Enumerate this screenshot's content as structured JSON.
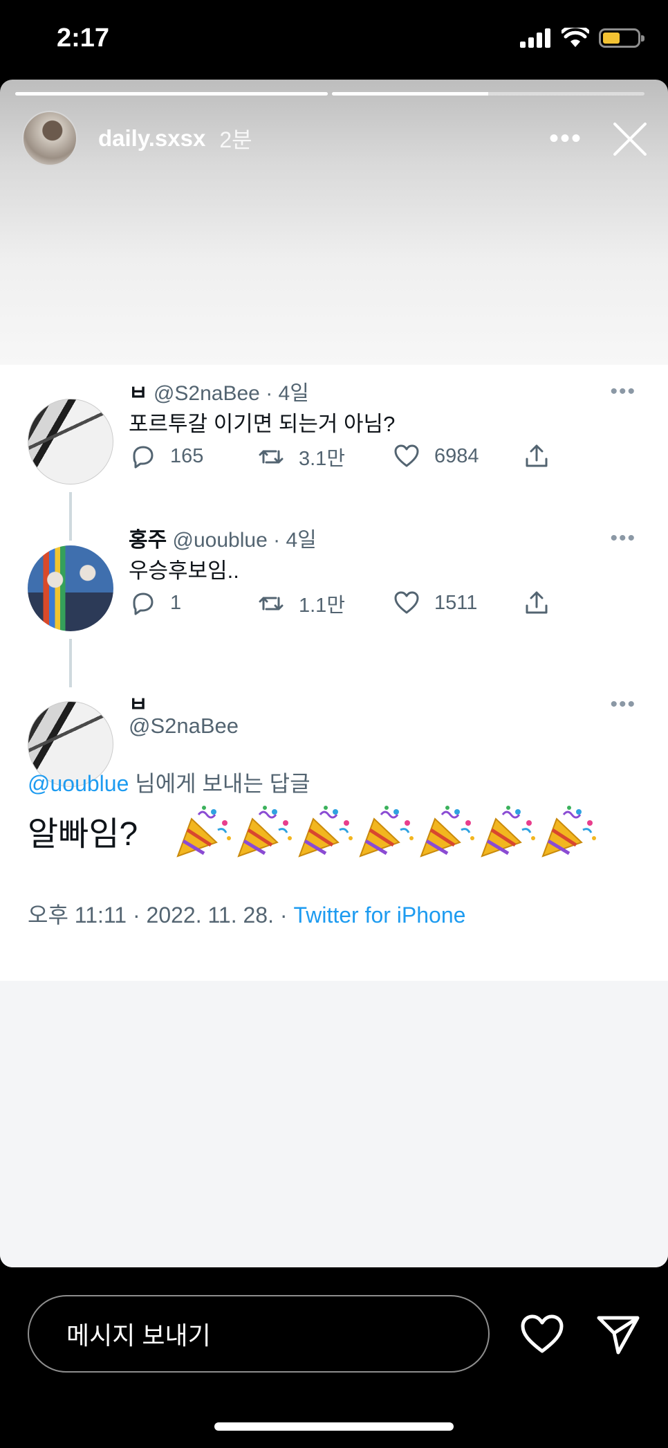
{
  "status_bar": {
    "time": "2:17"
  },
  "story": {
    "username": "daily.sxsx",
    "time_ago": "2분",
    "progress": [
      1.0,
      0.5
    ]
  },
  "thread": [
    {
      "name": "ㅂ",
      "handle": "@S2naBee",
      "age": "· 4일",
      "text": "포르투갈 이기면 되는거 아님?",
      "replies": "165",
      "retweets": "3.1만",
      "likes": "6984"
    },
    {
      "name": "홍주",
      "handle": "@uoublue",
      "age": "· 4일",
      "text": "우승후보임..",
      "replies": "1",
      "retweets": "1.1만",
      "likes": "1511"
    }
  ],
  "main_tweet": {
    "name": "ㅂ",
    "handle": "@S2naBee",
    "reply_to_handle": "@uoublue",
    "reply_to_suffix": " 님에게 보내는 답글",
    "text": "알빠임?",
    "emoji_count": 7,
    "timestamp": "오후 11:11 · 2022. 11. 28. · ",
    "source": "Twitter for iPhone"
  },
  "bottom_bar": {
    "message_placeholder": "메시지 보내기"
  },
  "colors": {
    "link": "#1d9bf0",
    "secondary_text": "#536471",
    "battery": "#f3c233"
  }
}
